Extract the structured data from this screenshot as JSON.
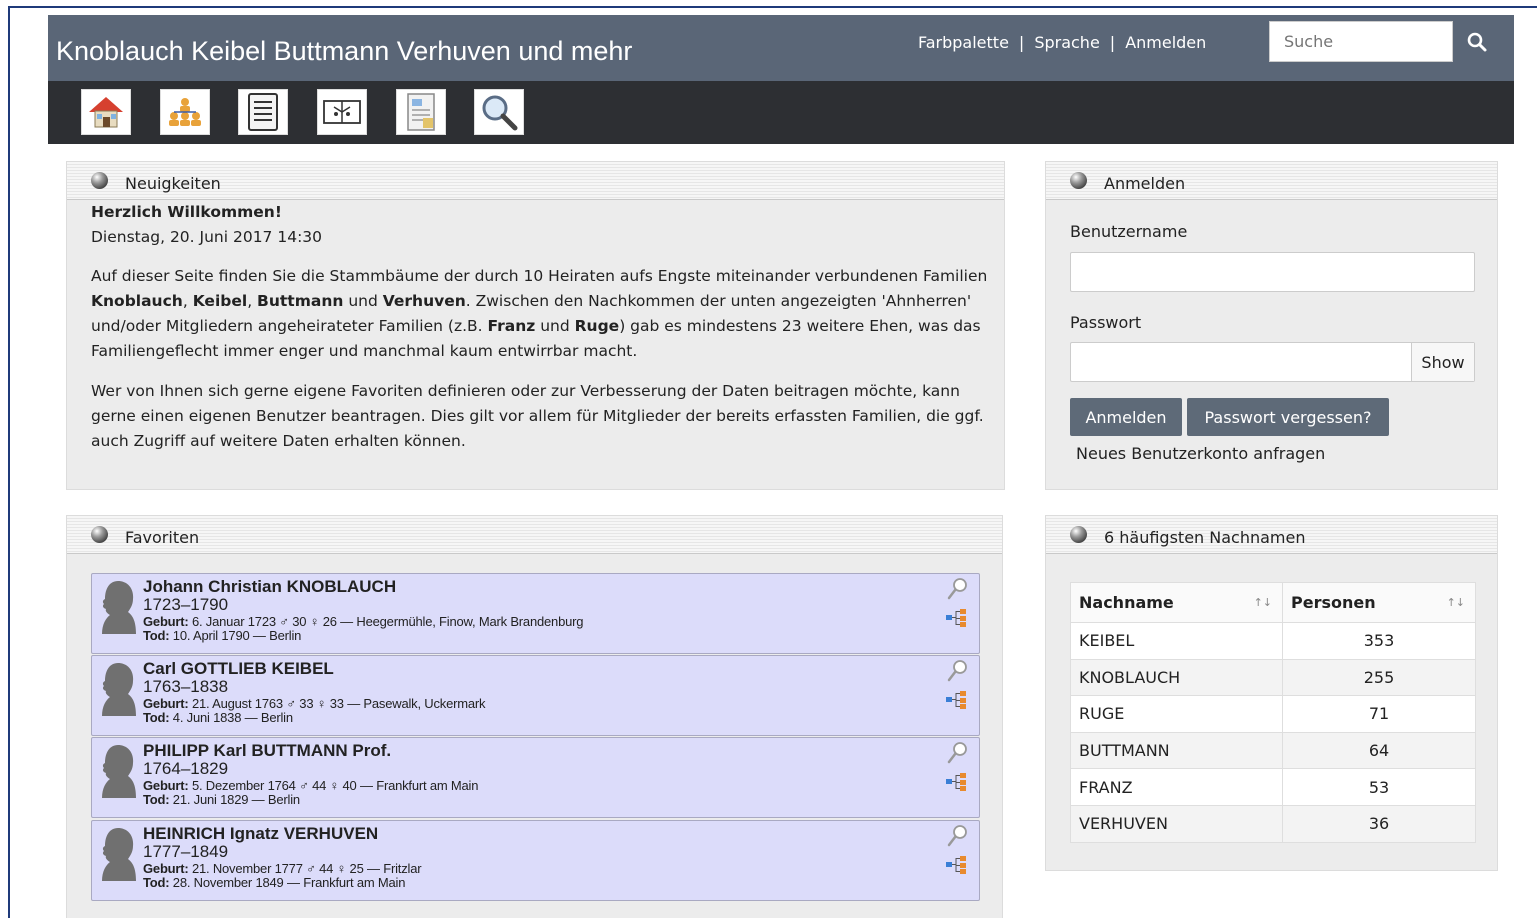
{
  "header": {
    "site_title": "Knoblauch Keibel Buttmann Verhuven und mehr",
    "links": [
      "Farbpalette",
      "Sprache",
      "Anmelden"
    ],
    "search_placeholder": "Suche"
  },
  "toolbar": {
    "icons": [
      "home-icon",
      "family-tree-icon",
      "list-icon",
      "book-icon",
      "document-icon",
      "magnifier-icon"
    ]
  },
  "news": {
    "title": "Neuigkeiten",
    "heading": "Herzlich Willkommen!",
    "date": "Dienstag, 20. Juni 2017 14:30",
    "p1": {
      "a": "Auf dieser Seite finden Sie die Stammbäume der durch 10 Heiraten aufs Engste miteinander verbundenen Familien ",
      "b1": "Knoblauch",
      "c1": ", ",
      "b2": "Keibel",
      "c2": ", ",
      "b3": "Buttmann",
      "c3": " und ",
      "b4": "Verhuven",
      "c4": ". Zwischen den Nachkommen der unten angezeigten 'Ahnherren' und/oder Mitgliedern angeheirateter Familien (z.B. ",
      "b5": "Franz",
      "c5": " und ",
      "b6": "Ruge",
      "c6": ") gab es mindestens 23 weitere Ehen, was das Familiengeflecht immer enger und manchmal kaum entwirrbar macht."
    },
    "p2": "Wer von Ihnen sich gerne eigene Favoriten definieren oder zur Verbesserung der Daten beitragen möchte, kann gerne einen eigenen Benutzer beantragen. Dies gilt vor allem für Mitglieder der bereits erfassten Familien, die ggf. auch Zugriff auf weitere Daten erhalten können."
  },
  "login": {
    "title": "Anmelden",
    "username_label": "Benutzername",
    "password_label": "Passwort",
    "show_label": "Show",
    "login_button": "Anmelden",
    "forgot_button": "Passwort vergessen?",
    "new_account": "Neues Benutzerkonto anfragen"
  },
  "favorites": {
    "title": "Favoriten",
    "birth_label": "Geburt:",
    "death_label": "Tod:",
    "items": [
      {
        "name": "Johann Christian KNOBLAUCH",
        "years": "1723–1790",
        "birth": " 6. Januar 1723 ♂ 30 ♀ 26 — Heegermühle, Finow, Mark Brandenburg",
        "death": " 10. April 1790 — Berlin"
      },
      {
        "name": "Carl GOTTLIEB KEIBEL",
        "years": "1763–1838",
        "birth": " 21. August 1763 ♂ 33 ♀ 33 — Pasewalk, Uckermark",
        "death": " 4. Juni 1838 — Berlin"
      },
      {
        "name": "PHILIPP Karl BUTTMANN Prof.",
        "years": "1764–1829",
        "birth": " 5. Dezember 1764 ♂ 44 ♀ 40 — Frankfurt am Main",
        "death": " 21. Juni 1829 — Berlin"
      },
      {
        "name": "HEINRICH Ignatz VERHUVEN",
        "years": "1777–1849",
        "birth": " 21. November 1777 ♂ 44 ♀ 25 — Fritzlar",
        "death": " 28. November 1849 — Frankfurt am Main"
      }
    ]
  },
  "surnames": {
    "title": "6 häufigsten Nachnamen",
    "col1": "Nachname",
    "col2": "Personen",
    "sort1": "↑↓",
    "sort2": "↑↓",
    "rows": [
      {
        "name": "KEIBEL",
        "count": "353"
      },
      {
        "name": "KNOBLAUCH",
        "count": "255"
      },
      {
        "name": "RUGE",
        "count": "71"
      },
      {
        "name": "BUTTMANN",
        "count": "64"
      },
      {
        "name": "FRANZ",
        "count": "53"
      },
      {
        "name": "VERHUVEN",
        "count": "36"
      }
    ]
  }
}
